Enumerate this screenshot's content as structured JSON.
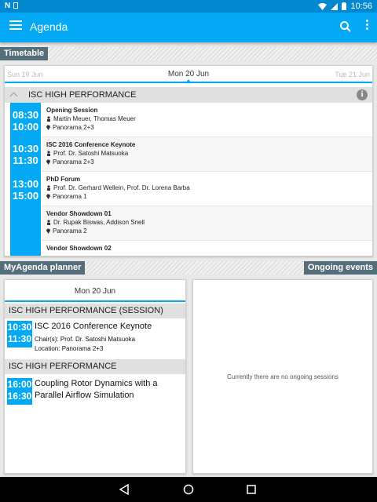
{
  "status_bar": {
    "left_icons": [
      "notification-n-icon",
      "sim-icon"
    ],
    "time": "10:56",
    "right_icons": [
      "wifi-icon",
      "signal-icon",
      "battery-icon"
    ]
  },
  "app_bar": {
    "title": "Agenda"
  },
  "timetable": {
    "label": "Timetable",
    "prev_day": "Sun 19 Jun",
    "current_day": "Mon 20 Jun",
    "next_day": "Tue 21 Jun",
    "track": "ISC HIGH PERFORMANCE",
    "time_slots": [
      {
        "start": "08:30",
        "end": "10:00"
      },
      {
        "start": "10:30",
        "end": "11:30"
      },
      {
        "start": "13:00",
        "end": "15:00"
      }
    ],
    "sessions": [
      {
        "title": "Opening Session",
        "people": "Martin Meuer, Thomas Meuer",
        "room": "Panorama 2+3"
      },
      {
        "title": "ISC 2016 Conference Keynote",
        "people": "Prof. Dr. Satoshi Matsuoka",
        "room": "Panorama 2+3"
      },
      {
        "title": "PhD Forum",
        "people": "Prof. Dr. Gerhard Wellein, Prof. Dr. Lorena Barba",
        "room": "Panorama 1"
      },
      {
        "title": "Vendor Showdown 01",
        "people": "Dr. Rupak Biswas, Addison Snell",
        "room": "Panorama 2"
      },
      {
        "title": "Vendor Showdown 02",
        "people": "",
        "room": ""
      }
    ]
  },
  "planner": {
    "label": "MyAgenda planner",
    "current_day": "Mon 20 Jun",
    "groups": [
      {
        "header": "ISC HIGH PERFORMANCE (SESSION)",
        "start": "10:30",
        "end": "11:30",
        "title": "ISC 2016 Conference Keynote",
        "chair": "Chair(s): Prof. Dr. Satoshi Matsuoka",
        "location": "Location: Panorama 2+3"
      },
      {
        "header": "ISC HIGH PERFORMANCE",
        "start": "16:00",
        "end": "16:30",
        "title_line1": "Coupling Rotor Dynamics with a",
        "title_line2": "Parallel Airflow Simulation"
      }
    ]
  },
  "ongoing": {
    "label": "Ongoing events",
    "empty_text": "Currently there are no ongoing sessions"
  },
  "colors": {
    "primary": "#03a9f4",
    "primary_dark": "#0288d1",
    "tag": "#546e7a"
  }
}
